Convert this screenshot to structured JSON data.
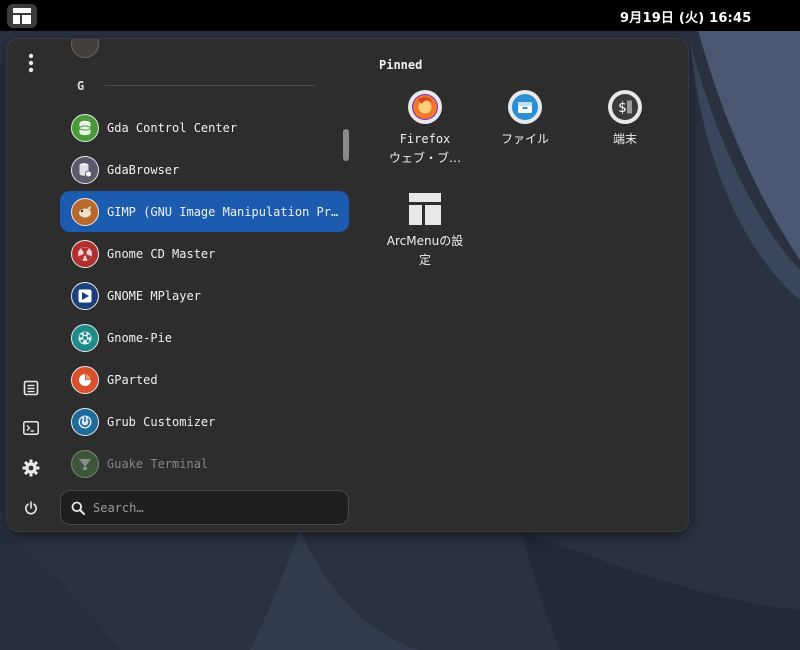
{
  "topbar": {
    "clock": "9月19日 (火) 16:45",
    "activities_icon": "arcmenu-layout-icon"
  },
  "menu": {
    "side_buttons": [
      {
        "name": "more-options-icon"
      },
      {
        "name": "documents-icon"
      },
      {
        "name": "terminal-icon"
      },
      {
        "name": "settings-gear-icon"
      },
      {
        "name": "power-icon"
      }
    ],
    "section_letter": "G",
    "apps": [
      {
        "label": "Gda Control Center",
        "icon": "database-icon",
        "color": "#4a9a3a"
      },
      {
        "label": "GdaBrowser",
        "icon": "database-gear-icon",
        "color": "#5a5a6a"
      },
      {
        "label": "GIMP (GNU Image Manipulation Program)",
        "icon": "gimp-icon",
        "color": "#b8692a"
      },
      {
        "label": "Gnome CD Master",
        "icon": "radiation-icon",
        "color": "#b03030"
      },
      {
        "label": "GNOME MPlayer",
        "icon": "play-icon",
        "color": "#1e3f7a"
      },
      {
        "label": "Gnome-Pie",
        "icon": "pie-icon",
        "color": "#1f8a8a"
      },
      {
        "label": "GParted",
        "icon": "gparted-icon",
        "color": "#d9502a"
      },
      {
        "label": "Grub Customizer",
        "icon": "power-circle-icon",
        "color": "#1e6a9a"
      },
      {
        "label": "Guake Terminal",
        "icon": "guake-icon",
        "color": "#4a8a4a"
      }
    ],
    "search": {
      "placeholder": "Search…"
    }
  },
  "pinned": {
    "title": "Pinned",
    "items": [
      {
        "label_line1": "Firefox",
        "label_line2": "ウェブ・ブ…",
        "icon": "firefox-icon"
      },
      {
        "label_line1": "ファイル",
        "label_line2": "",
        "icon": "files-icon"
      },
      {
        "label_line1": "端末",
        "label_line2": "",
        "icon": "terminal-app-icon"
      },
      {
        "label_line1": "ArcMenuの設",
        "label_line2": "定",
        "icon": "arcmenu-settings-icon"
      }
    ]
  }
}
